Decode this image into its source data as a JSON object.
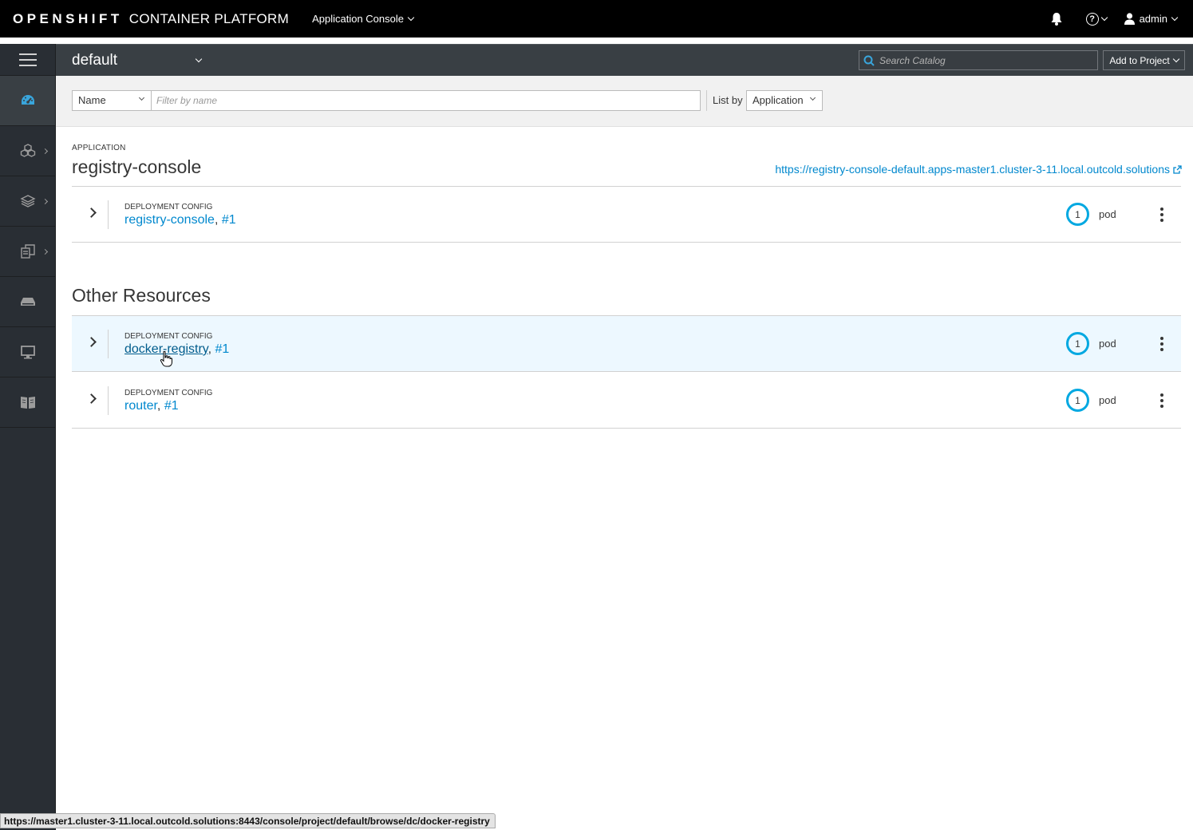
{
  "masthead": {
    "brand_bold": "OPENSHIFT",
    "brand_rest": "CONTAINER PLATFORM",
    "context_switcher": "Application Console",
    "user": "admin",
    "icons": [
      "bell-icon",
      "help-icon",
      "user-icon"
    ]
  },
  "sidebar": {
    "items": [
      {
        "name": "overview",
        "icon": "dashboard-icon",
        "active": true,
        "has_submenu": false
      },
      {
        "name": "applications",
        "icon": "cubes-icon",
        "active": false,
        "has_submenu": true
      },
      {
        "name": "builds",
        "icon": "layers-icon",
        "active": false,
        "has_submenu": true
      },
      {
        "name": "resources",
        "icon": "files-icon",
        "active": false,
        "has_submenu": true
      },
      {
        "name": "storage",
        "icon": "storage-icon",
        "active": false,
        "has_submenu": false
      },
      {
        "name": "monitoring",
        "icon": "monitor-icon",
        "active": false,
        "has_submenu": false
      },
      {
        "name": "catalog",
        "icon": "book-icon",
        "active": false,
        "has_submenu": false
      }
    ]
  },
  "projectbar": {
    "project": "default",
    "search_placeholder": "Search Catalog",
    "add_to_project": "Add to Project"
  },
  "filterbar": {
    "filter_field": "Name",
    "filter_placeholder": "Filter by name",
    "list_by_label": "List by",
    "list_by_value": "Application"
  },
  "application": {
    "kicker": "APPLICATION",
    "name": "registry-console",
    "route": "https://registry-console-default.apps-master1.cluster-3-11.local.outcold.solutions",
    "rows": [
      {
        "kicker": "DEPLOYMENT CONFIG",
        "name": "registry-console",
        "sep": ",",
        "version": "#1",
        "pods": "1",
        "pod_label": "pod"
      }
    ]
  },
  "other_resources": {
    "title": "Other Resources",
    "rows": [
      {
        "kicker": "DEPLOYMENT CONFIG",
        "name": "docker-registry",
        "sep": ",",
        "version": "#1",
        "pods": "1",
        "pod_label": "pod"
      },
      {
        "kicker": "DEPLOYMENT CONFIG",
        "name": "router",
        "sep": ",",
        "version": "#1",
        "pods": "1",
        "pod_label": "pod"
      }
    ]
  },
  "status_bar": {
    "url": "https://master1.cluster-3-11.local.outcold.solutions:8443/console/project/default/browse/dc/docker-registry"
  },
  "colors": {
    "masthead_bg": "#000000",
    "sidebar_bg": "#292e34",
    "link": "#0088ce",
    "donut": "#00a8e1",
    "hover_row": "#edf8ff"
  }
}
